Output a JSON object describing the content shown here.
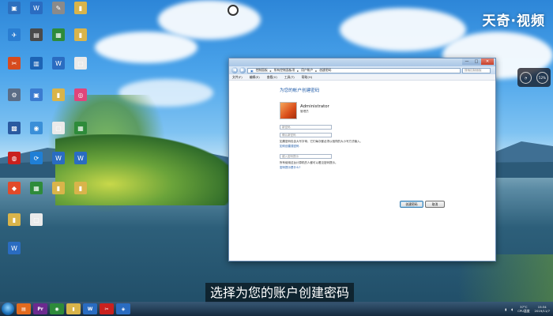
{
  "watermark": "天奇·视频",
  "subtitle": "选择为您的账户创建密码",
  "desktop_icons": [
    {
      "id": "i1",
      "label": "",
      "color": "#2c6fbe",
      "glyph": "▣"
    },
    {
      "id": "i2",
      "label": "",
      "color": "#2a6cc1",
      "glyph": "W"
    },
    {
      "id": "i3",
      "label": "",
      "color": "#8a8a8a",
      "glyph": "✎"
    },
    {
      "id": "i4",
      "label": "",
      "color": "#d9b44a",
      "glyph": "▮"
    },
    {
      "id": "i5",
      "label": "",
      "color": "#2a7dd1",
      "glyph": "✈"
    },
    {
      "id": "i6",
      "label": "",
      "color": "#4a4a4a",
      "glyph": "▤"
    },
    {
      "id": "i7",
      "label": "",
      "color": "#2e8b3a",
      "glyph": "▦"
    },
    {
      "id": "i8",
      "label": "",
      "color": "#d9b44a",
      "glyph": "▮"
    },
    {
      "id": "i9",
      "label": "",
      "color": "#d64b1f",
      "glyph": "✂"
    },
    {
      "id": "i10",
      "label": "",
      "color": "#1d64b5",
      "glyph": "▥"
    },
    {
      "id": "i11",
      "label": "",
      "color": "#2a6cc1",
      "glyph": "W"
    },
    {
      "id": "i12",
      "label": "",
      "color": "#eaeaea",
      "glyph": "▢"
    },
    {
      "id": "i13",
      "label": "",
      "color": "#5a6d86",
      "glyph": "⚙"
    },
    {
      "id": "i14",
      "label": "",
      "color": "#3b7bd0",
      "glyph": "▣"
    },
    {
      "id": "i15",
      "label": "",
      "color": "#d9b44a",
      "glyph": "▮"
    },
    {
      "id": "i16",
      "label": "",
      "color": "#e0457b",
      "glyph": "◎"
    },
    {
      "id": "i17",
      "label": "",
      "color": "#2a5aa0",
      "glyph": "▩"
    },
    {
      "id": "i18",
      "label": "",
      "color": "#3a8fd8",
      "glyph": "◉"
    },
    {
      "id": "i19",
      "label": "",
      "color": "#eaeaea",
      "glyph": "▢"
    },
    {
      "id": "i20",
      "label": "",
      "color": "#2e8b3a",
      "glyph": "▦"
    },
    {
      "id": "i21",
      "label": "",
      "color": "#c9211e",
      "glyph": "◍"
    },
    {
      "id": "i22",
      "label": "",
      "color": "#1f7fd6",
      "glyph": "⟳"
    },
    {
      "id": "i23",
      "label": "",
      "color": "#2a6cc1",
      "glyph": "W"
    },
    {
      "id": "i24",
      "label": "",
      "color": "#2a6cc1",
      "glyph": "W"
    },
    {
      "id": "i25",
      "label": "",
      "color": "#e24a2a",
      "glyph": "◆"
    },
    {
      "id": "i26",
      "label": "",
      "color": "#2e8b3a",
      "glyph": "▦"
    },
    {
      "id": "i27",
      "label": "",
      "color": "#d9b44a",
      "glyph": "▮"
    },
    {
      "id": "i28",
      "label": "",
      "color": "#d9b44a",
      "glyph": "▮"
    },
    {
      "id": "i29",
      "label": "",
      "color": "#d9b44a",
      "glyph": "▮"
    },
    {
      "id": "i30",
      "label": "",
      "color": "#eaeaea",
      "glyph": "▢"
    },
    {
      "id": "i31",
      "label": "",
      "color": "#2a6cc1",
      "glyph": "W"
    }
  ],
  "window": {
    "minimize": "—",
    "maximize": "□",
    "close": "✕",
    "address_segments": [
      "控制面板",
      "所有控制面板项",
      "用户帐户",
      "创建密码"
    ],
    "search_placeholder": "搜索控制面板",
    "menu": [
      "文件(F)",
      "编辑(E)",
      "查看(V)",
      "工具(T)",
      "帮助(H)"
    ],
    "page_title": "为您的帐户创建密码",
    "username": "Administrator",
    "usertype": "管理员",
    "new_password_placeholder": "新密码",
    "confirm_password_placeholder": "确认新密码",
    "hint1": "如果密码包含大写字母，它们每次都必须以相同的大小写方式输入。",
    "link1": "如何创建强密码",
    "hint_placeholder": "键入密码提示",
    "hint2": "所有使用这台计算机的人都可以看见密码提示。",
    "link2": "密码提示是什么?",
    "create_button": "创建密码",
    "cancel_button": "取消"
  },
  "gadget": {
    "value": "52%"
  },
  "tray": {
    "temp": "37°C",
    "cpu": "CPU温度",
    "time": "15:34",
    "date": "2019/11/7"
  },
  "taskbar_apps": [
    {
      "id": "t1",
      "color": "#e26a1e",
      "glyph": "▤"
    },
    {
      "id": "t2",
      "color": "#6b2a8f",
      "glyph": "Pr"
    },
    {
      "id": "t3",
      "color": "#2d8a3a",
      "glyph": "◉"
    },
    {
      "id": "t4",
      "color": "#d9b44a",
      "glyph": "▮"
    },
    {
      "id": "t5",
      "color": "#2a6cc1",
      "glyph": "W"
    },
    {
      "id": "t6",
      "color": "#c9211e",
      "glyph": "✂"
    },
    {
      "id": "t7",
      "color": "#2a6cc1",
      "glyph": "◈"
    }
  ],
  "colors": {
    "accent": "#1e5aa8",
    "close": "#c6412a"
  }
}
